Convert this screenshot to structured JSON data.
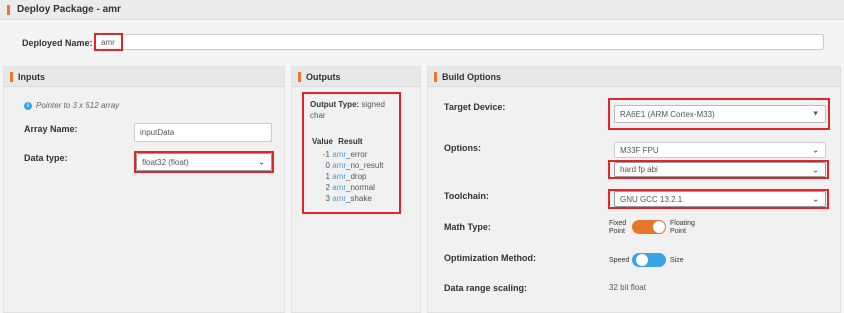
{
  "header": {
    "title": "Deploy Package - amr"
  },
  "deploy": {
    "label": "Deployed Name:",
    "value": "amr"
  },
  "inputs": {
    "title": "Inputs",
    "hint": "Pointer to 3 x 512 array",
    "array_label": "Array Name:",
    "array_value": "inputData",
    "dtype_label": "Data type:",
    "dtype_value": "float32 (float)"
  },
  "outputs": {
    "title": "Outputs",
    "type_label": "Output Type:",
    "type_value_1": "signed",
    "type_value_2": "char",
    "col_value": "Value",
    "col_result": "Result",
    "rows": [
      {
        "value": "-1",
        "prefix": "amr",
        "suffix": "_error"
      },
      {
        "value": "0",
        "prefix": "amr",
        "suffix": "_no_result"
      },
      {
        "value": "1",
        "prefix": "amr",
        "suffix": "_drop"
      },
      {
        "value": "2",
        "prefix": "amr",
        "suffix": "_normal"
      },
      {
        "value": "3",
        "prefix": "amr",
        "suffix": "_shake"
      }
    ]
  },
  "build": {
    "title": "Build Options",
    "target_label": "Target Device:",
    "target_value": "RA6E1 (ARM Cortex-M33)",
    "options_label": "Options:",
    "fpu_value": "M33F FPU",
    "abi_value": "hard fp abi",
    "toolchain_label": "Toolchain:",
    "toolchain_value": "GNU GCC 13.2.1",
    "math_label": "Math Type:",
    "math_left_1": "Fixed",
    "math_left_2": "Point",
    "math_right_1": "Floating",
    "math_right_2": "Point",
    "opt_label": "Optimization Method:",
    "opt_left": "Speed",
    "opt_right": "Size",
    "scaling_label": "Data range scaling:",
    "scaling_value": "32 bit float"
  },
  "colors": {
    "accent": "#e8772e",
    "highlight": "#e0252b",
    "toggle_on": "#e8772e",
    "toggle_blue": "#3aa3e6",
    "link": "#4a9fd8"
  },
  "icons": {
    "hint": "info-circle-icon",
    "dropdown": "chevron-down-icon",
    "caret": "caret-down-icon"
  }
}
